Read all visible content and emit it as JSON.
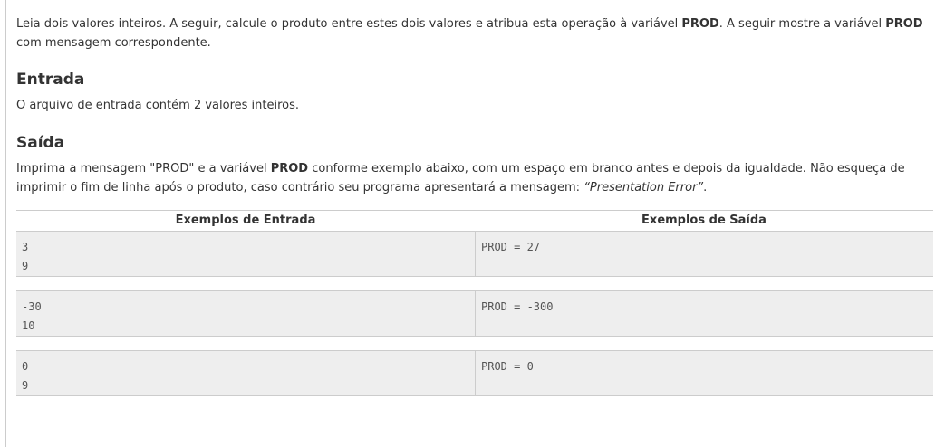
{
  "intro": {
    "t1": "Leia dois valores inteiros. A seguir, calcule o produto entre estes dois valores e atribua esta operação à variável ",
    "b1": "PROD",
    "t2": ". A seguir mostre a variável ",
    "b2": "PROD",
    "t3": " com mensagem correspondente."
  },
  "entrada": {
    "heading": "Entrada",
    "text": "O arquivo de entrada contém 2 valores inteiros."
  },
  "saida": {
    "heading": "Saída",
    "t1": "Imprima a mensagem \"PROD\" e a variável ",
    "b1": "PROD",
    "t2": " conforme exemplo abaixo, com um espaço em branco antes e depois da igualdade. Não esqueça de imprimir o fim de linha após o produto, caso contrário seu programa apresentará a mensagem: ",
    "i1": "“Presentation Error”",
    "t3": "."
  },
  "examples": {
    "input_header": "Exemplos de Entrada",
    "output_header": "Exemplos de Saída",
    "rows": [
      {
        "input": [
          "3",
          "9"
        ],
        "output": [
          "PROD = 27"
        ]
      },
      {
        "input": [
          "-30",
          "10"
        ],
        "output": [
          "PROD = -300"
        ]
      },
      {
        "input": [
          "0",
          "9"
        ],
        "output": [
          "PROD = 0"
        ]
      }
    ]
  }
}
